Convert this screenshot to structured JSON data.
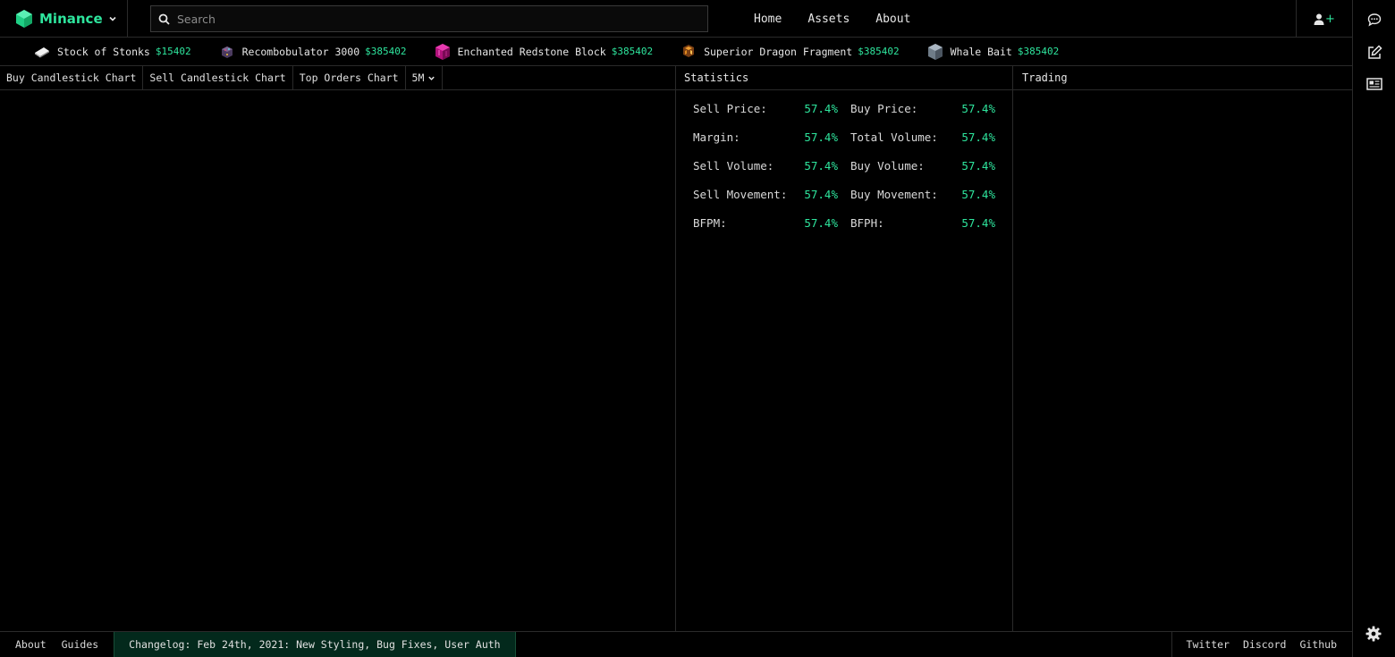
{
  "brand": {
    "name": "Minance",
    "logo_icon": "hex-cube-logo-icon",
    "accent": "#2ee59d"
  },
  "search": {
    "placeholder": "Search"
  },
  "nav": {
    "home": "Home",
    "assets": "Assets",
    "about": "About"
  },
  "ticker": [
    {
      "name": "Stock of Stonks",
      "price": "$15402",
      "icon": "paper-stock-icon"
    },
    {
      "name": "Recombobulator 3000",
      "price": "$385402",
      "icon": "recombobulator-icon"
    },
    {
      "name": "Enchanted Redstone Block",
      "price": "$385402",
      "icon": "redstone-block-icon"
    },
    {
      "name": "Superior Dragon Fragment",
      "price": "$385402",
      "icon": "dragon-fragment-icon"
    },
    {
      "name": "Whale Bait",
      "price": "$385402",
      "icon": "whale-bait-icon"
    }
  ],
  "chart_tabs": {
    "buy": "Buy Candlestick Chart",
    "sell": "Sell Candlestick Chart",
    "top_orders": "Top Orders Chart",
    "interval": "5M"
  },
  "statistics": {
    "title": "Statistics",
    "rows": [
      [
        {
          "label": "Sell Price:",
          "value": "57.4%"
        },
        {
          "label": "Buy Price:",
          "value": "57.4%"
        }
      ],
      [
        {
          "label": "Margin:",
          "value": "57.4%"
        },
        {
          "label": "Total Volume:",
          "value": "57.4%"
        }
      ],
      [
        {
          "label": "Sell Volume:",
          "value": "57.4%"
        },
        {
          "label": "Buy Volume:",
          "value": "57.4%"
        }
      ],
      [
        {
          "label": "Sell Movement:",
          "value": "57.4%"
        },
        {
          "label": "Buy Movement:",
          "value": "57.4%"
        }
      ],
      [
        {
          "label": "BFPM:",
          "value": "57.4%"
        },
        {
          "label": "BFPH:",
          "value": "57.4%"
        }
      ]
    ]
  },
  "trading": {
    "title": "Trading"
  },
  "footer": {
    "about": "About",
    "guides": "Guides",
    "changelog": "Changelog: Feb 24th, 2021: New Styling, Bug Fixes, User Auth",
    "twitter": "Twitter",
    "discord": "Discord",
    "github": "Github"
  },
  "rail_icons": [
    "chat-icon",
    "edit-icon",
    "news-icon",
    "gear-icon"
  ]
}
